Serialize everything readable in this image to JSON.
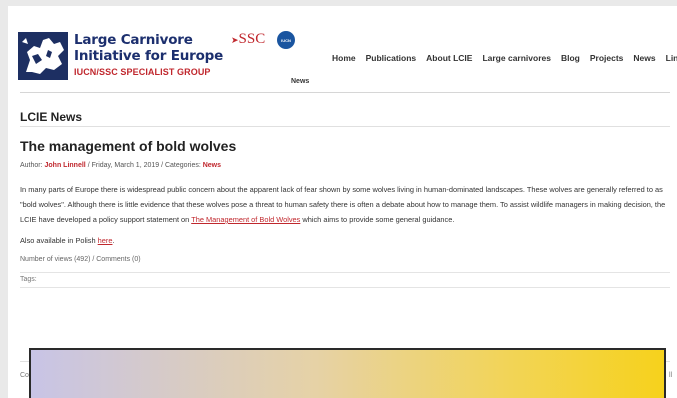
{
  "logo": {
    "title_line1": "Large Carnivore",
    "title_line2": "Initiative for Europe",
    "subtitle": "IUCN/SSC SPECIALIST GROUP",
    "ssc": "SSC",
    "iucn": "IUCN"
  },
  "header": {
    "news_small": "News"
  },
  "nav": {
    "items": [
      "Home",
      "Publications",
      "About LCIE",
      "Large carnivores",
      "Blog",
      "Projects",
      "News",
      "Links"
    ]
  },
  "section_title": "LCIE News",
  "article": {
    "title": "The management of bold wolves",
    "meta": {
      "author_prefix": "Author: ",
      "author": "John Linnell",
      "date": " / Friday, March 1, 2019 / Categories: ",
      "category": "News"
    },
    "body_part1": "In many parts of Europe there is widespread public concern about the apparent lack of fear shown by some wolves living in human-dominated landscapes. These wolves are generally referred to as \"bold wolves\". Although there is little evidence that these wolves pose a threat to human safety there is often a debate about how to manage them. To assist wildlife managers in making decision, the LCIE have developed a policy support statement on ",
    "body_link": "The Management of Bold Wolves",
    "body_part2": " which aims to provide some general guidance.",
    "also_prefix": "Also available in Polish ",
    "also_link": "here",
    "also_suffix": ".",
    "views": "Number of views (492) / Comments (0)",
    "tags": "Tags:"
  },
  "footer": {
    "left": "Co",
    "right": "ll"
  },
  "colors": {
    "brand_red": "#c0272d",
    "brand_blue": "#1c2f6e"
  }
}
